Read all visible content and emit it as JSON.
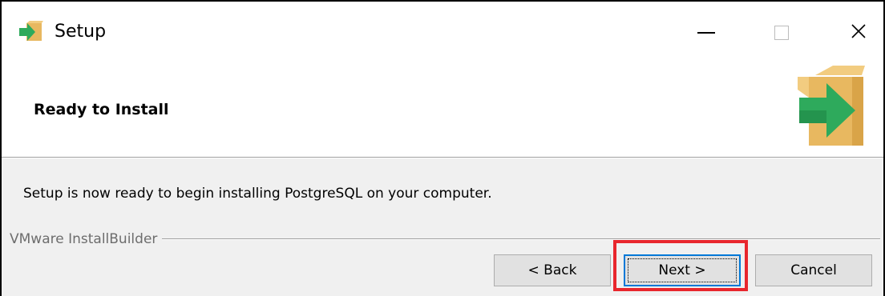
{
  "window": {
    "title": "Setup",
    "app_icon": "installer-arrow-icon",
    "controls": {
      "minimize_icon": "minimize-icon",
      "maximize_icon": "maximize-icon",
      "close_icon": "close-icon",
      "close_glyph": "✕"
    }
  },
  "header": {
    "title": "Ready to Install",
    "graphic_icon": "box-arrow-icon"
  },
  "body": {
    "message": "Setup is now ready to begin installing PostgreSQL on your computer."
  },
  "footer": {
    "brand": "VMware InstallBuilder",
    "buttons": {
      "back_label": "< Back",
      "next_label": "Next >",
      "cancel_label": "Cancel"
    }
  },
  "colors": {
    "highlight": "#e8262d",
    "focus_border": "#0078d7",
    "box_tan": "#e8b860",
    "arrow_green": "#2eaa5c"
  }
}
